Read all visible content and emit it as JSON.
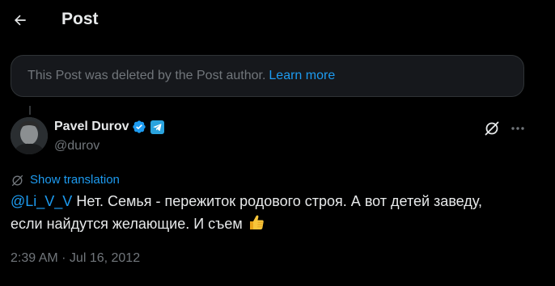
{
  "header": {
    "title": "Post",
    "back_icon": "arrow-left-icon"
  },
  "deleted_notice": {
    "text": "This Post was deleted by the Post author.",
    "link": "Learn more"
  },
  "post": {
    "author_name": "Pavel Durov",
    "author_handle": "@durov",
    "show_translation": "Show translation",
    "mention": "@Li_V_V",
    "text_line1_after_mention": " Нет. Семья - пережиток родового строя. А вот детей заведу,",
    "text_line2": "если найдутся желающие. И съем",
    "timestamp": "2:39 AM · Jul 16, 2012"
  },
  "colors": {
    "background": "#000000",
    "text_primary": "#e7e9ea",
    "text_secondary": "#71767b",
    "accent": "#1d9bf0",
    "notice_bg": "#16181c",
    "border": "#2f3336"
  }
}
